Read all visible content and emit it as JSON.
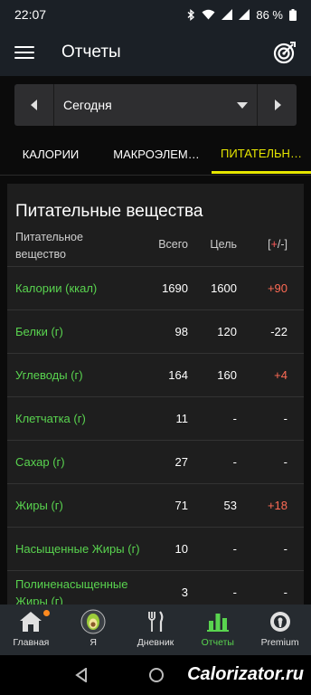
{
  "status": {
    "time": "22:07",
    "battery": "86 %"
  },
  "app": {
    "title": "Отчеты"
  },
  "date_selector": {
    "value": "Сегодня"
  },
  "tabs": [
    {
      "label": "КАЛОРИИ"
    },
    {
      "label": "МАКРОЭЛЕМ…"
    },
    {
      "label": "ПИТАТЕЛЬН…"
    }
  ],
  "table": {
    "title": "Питательные вещества",
    "headers": {
      "name": "Питательное вещество",
      "total": "Всего",
      "goal": "Цель",
      "diff_open": "[",
      "diff_plus": "+",
      "diff_rest": "/-]"
    },
    "rows": [
      {
        "name": "Калории (ккал)",
        "total": "1690",
        "goal": "1600",
        "diff": "+90"
      },
      {
        "name": "Белки (г)",
        "total": "98",
        "goal": "120",
        "diff": "-22"
      },
      {
        "name": "Углеводы (г)",
        "total": "164",
        "goal": "160",
        "diff": "+4"
      },
      {
        "name": "Клетчатка (г)",
        "total": "11",
        "goal": "-",
        "diff": "-"
      },
      {
        "name": "Сахар (г)",
        "total": "27",
        "goal": "-",
        "diff": "-"
      },
      {
        "name": "Жиры (г)",
        "total": "71",
        "goal": "53",
        "diff": "+18"
      },
      {
        "name": "Насыщенные Жиры (г)",
        "total": "10",
        "goal": "-",
        "diff": "-"
      },
      {
        "name": "Полиненасыщенные Жиры (г)",
        "total": "3",
        "goal": "-",
        "diff": "-"
      }
    ]
  },
  "bottom_nav": [
    {
      "label": "Главная",
      "icon": "home-icon"
    },
    {
      "label": "Я",
      "icon": "avocado-icon"
    },
    {
      "label": "Дневник",
      "icon": "fork-knife-icon"
    },
    {
      "label": "Отчеты",
      "icon": "bar-chart-icon"
    },
    {
      "label": "Premium",
      "icon": "premium-badge-icon"
    }
  ],
  "watermark": "Calorizator.ru",
  "colors": {
    "accent_yellow": "#e6e600",
    "green": "#59d44f",
    "over": "#ff6b55"
  }
}
